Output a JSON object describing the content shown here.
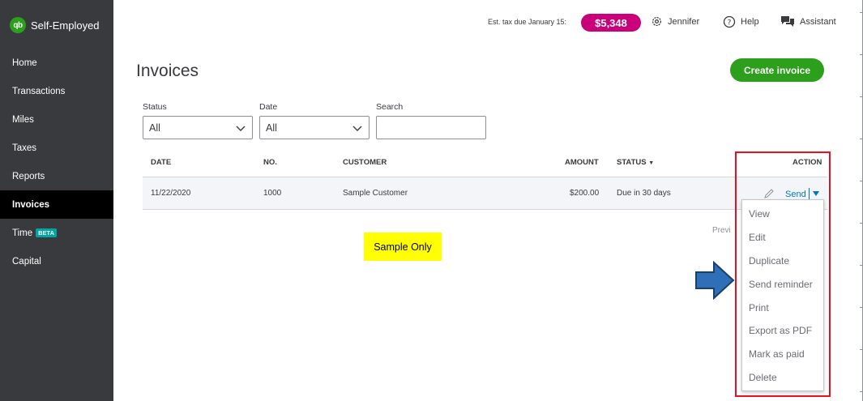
{
  "sidebar": {
    "brand": {
      "logo_text": "qb",
      "name": "Self-Employed"
    },
    "items": [
      {
        "label": "Home"
      },
      {
        "label": "Transactions"
      },
      {
        "label": "Miles"
      },
      {
        "label": "Taxes"
      },
      {
        "label": "Reports"
      },
      {
        "label": "Invoices",
        "active": true
      },
      {
        "label": "Time",
        "badge": "BETA"
      },
      {
        "label": "Capital"
      }
    ]
  },
  "header": {
    "tax_label": "Est. tax due January 15:",
    "tax_amount": "$5,348",
    "user_name": "Jennifer",
    "help_label": "Help",
    "assistant_label": "Assistant"
  },
  "page": {
    "title": "Invoices",
    "create_button": "Create invoice"
  },
  "filters": {
    "status": {
      "label": "Status",
      "value": "All"
    },
    "date": {
      "label": "Date",
      "value": "All"
    },
    "search": {
      "label": "Search",
      "value": "",
      "placeholder": ""
    }
  },
  "table": {
    "columns": {
      "date": "DATE",
      "no": "NO.",
      "customer": "CUSTOMER",
      "amount": "AMOUNT",
      "status": "STATUS",
      "status_sort": "▼",
      "action": "ACTION"
    },
    "rows": [
      {
        "date": "11/22/2020",
        "no": "1000",
        "customer": "Sample Customer",
        "amount": "$200.00",
        "status": "Due in 30 days",
        "action": "Send"
      }
    ],
    "pagination_partial": "Previ"
  },
  "action_menu": {
    "items": [
      "View",
      "Edit",
      "Duplicate",
      "Send reminder",
      "Print",
      "Export as PDF",
      "Mark as paid",
      "Delete"
    ]
  },
  "annotation": {
    "note": "Sample Only"
  },
  "colors": {
    "sidebar_bg": "#393a3d",
    "brand_green": "#2ca01c",
    "tax_badge": "#c9007a",
    "link_blue": "#0077c5",
    "highlight_red": "#e8101e",
    "note_yellow": "#ffff00",
    "arrow_blue": "#2e6fb7"
  },
  "icons": {
    "settings": "gear-icon",
    "help": "question-circle-icon",
    "assistant": "chat-bubbles-icon",
    "edit": "pencil-icon",
    "dropdown": "chevron-down-icon",
    "callout": "right-arrow-icon"
  }
}
